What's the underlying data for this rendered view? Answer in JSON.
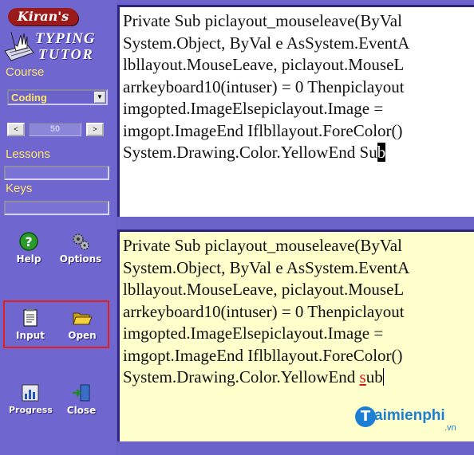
{
  "logo": {
    "brand": "Kiran's",
    "line1": "TYPING",
    "line2": "TUTOR"
  },
  "course": {
    "label": "Course",
    "selected": "Coding"
  },
  "level": {
    "decrement": "<",
    "value": "50",
    "increment": ">"
  },
  "lessons": {
    "label": "Lessons"
  },
  "keys": {
    "label": "Keys"
  },
  "toolbar": {
    "help": "Help",
    "options": "Options",
    "input": "Input",
    "open": "Open",
    "progress": "Progress",
    "close": "Close"
  },
  "source_text": {
    "lines": [
      "Private Sub piclayout_mouseleave(ByVal",
      "System.Object, ByVal e AsSystem.EventA",
      "lbllayout.MouseLeave, piclayout.MouseL",
      "arrkeyboard10(intuser) = 0 Thenpiclayout",
      "imgopted.ImageElsepiclayout.Image =",
      "imgopt.ImageEnd Iflbllayout.ForeColor()",
      "System.Drawing.Color.YellowEnd Su"
    ],
    "cursor_char": "b"
  },
  "typed_text": {
    "lines": [
      "Private Sub piclayout_mouseleave(ByVal",
      "System.Object, ByVal e AsSystem.EventA",
      "lbllayout.MouseLeave, piclayout.MouseL",
      "arrkeyboard10(intuser) = 0 Thenpiclayout",
      "imgopted.ImageElsepiclayout.Image =",
      "imgopt.ImageEnd Iflbllayout.ForeColor()",
      "System.Drawing.Color.YellowEnd "
    ],
    "error_char": "s",
    "last_tail": "ub"
  },
  "watermark": {
    "text": "aimienphi",
    "logo_letter": "T",
    "sub": ".vn"
  },
  "colors": {
    "panel": "#6f66cf",
    "label_yellow": "#ffe66a",
    "typed_bg": "#ffffcc",
    "highlight": "#e02020",
    "error": "#d01515"
  }
}
